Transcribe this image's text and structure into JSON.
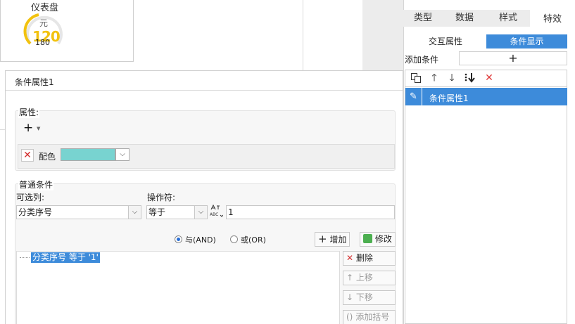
{
  "gauge": {
    "title": "仪表盘",
    "unit": "元",
    "value": "120",
    "max": "180"
  },
  "dialog": {
    "title": "条件属性1",
    "attributes": {
      "group_label": "属性:",
      "add_icon": "plus-icon",
      "row_name": "配色",
      "color": "#78d3d0"
    },
    "condition": {
      "group_label": "普通条件",
      "column_label": "可选列:",
      "column_value": "分类序号",
      "operator_label": "操作符:",
      "operator_value": "等于",
      "value": "1",
      "radio_and": "与(AND)",
      "radio_or": "或(OR)",
      "radio_selected": "and",
      "add_button": "增加",
      "modify_button": "修改",
      "list_item": "分类序号 等于 '1'",
      "delete_button": "删除",
      "up_button": "上移",
      "down_button": "下移",
      "bracket_button": "添加括号"
    }
  },
  "right_panel": {
    "tabs": [
      "类型",
      "数据",
      "样式",
      "特效"
    ],
    "active_tab": "特效",
    "sub_tabs": [
      "交互属性",
      "条件显示"
    ],
    "active_sub_tab": "条件显示",
    "add_condition_label": "添加条件",
    "add_condition_icon": "plus-icon",
    "toolbar_icons": [
      "copy-icon",
      "arrow-up-icon",
      "arrow-down-icon",
      "move-bottom-icon",
      "delete-icon"
    ],
    "conditions": [
      "条件属性1"
    ]
  },
  "colors": {
    "accent": "#3d8bda",
    "gauge_value": "#f2c20f",
    "delete": "#e03a3a"
  }
}
